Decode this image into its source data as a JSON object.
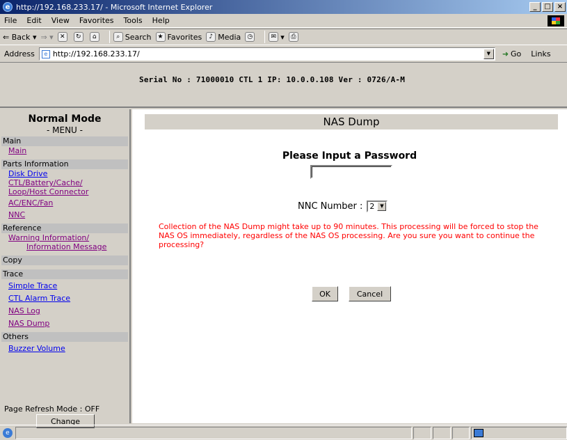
{
  "window": {
    "title": "http://192.168.233.17/ - Microsoft Internet Explorer"
  },
  "menubar": {
    "items": [
      "File",
      "Edit",
      "View",
      "Favorites",
      "Tools",
      "Help"
    ]
  },
  "toolbar": {
    "back": "Back",
    "search": "Search",
    "favorites": "Favorites",
    "media": "Media"
  },
  "address": {
    "label": "Address",
    "url": "http://192.168.233.17/",
    "go": "Go",
    "links": "Links"
  },
  "header": {
    "serial": "Serial No : 71000010  CTL 1  IP: 10.0.0.108  Ver : 0726/A-M"
  },
  "sidebar": {
    "mode": "Normal Mode",
    "menu_title": "- MENU -",
    "sections": {
      "main": "Main",
      "parts": "Parts Information",
      "reference": "Reference",
      "copy": "Copy",
      "trace": "Trace",
      "others": "Others"
    },
    "links": {
      "main": "Main",
      "disk_drive": "Disk Drive",
      "ctl_line1": "CTL/Battery/Cache/",
      "ctl_line2": "Loop/Host Connector",
      "ac_enc_fan": "AC/ENC/Fan",
      "nnc": "NNC",
      "warning_line1": "Warning Information/",
      "warning_line2": "Information Message",
      "simple_trace": "Simple Trace",
      "ctl_alarm_trace": "CTL Alarm Trace",
      "nas_log": "NAS Log",
      "nas_dump": "NAS Dump",
      "buzzer_volume": "Buzzer Volume"
    },
    "refresh_mode": "Page Refresh Mode : OFF",
    "change_button": "Change"
  },
  "main": {
    "title": "NAS Dump",
    "password_label": "Please Input a Password",
    "password_value": "",
    "nnc_label": "NNC Number :",
    "nnc_value": "2",
    "warning": "Collection of the NAS Dump might take up to 90 minutes. This processing will be forced to stop the NAS OS immediately, regardless of the NAS OS processing. Are you sure you want to continue the processing?",
    "ok_button": "OK",
    "cancel_button": "Cancel"
  },
  "colors": {
    "warning_text": "#ff0000",
    "visited_link": "#800080",
    "link": "#0000ee",
    "chrome": "#d4d0c8"
  }
}
